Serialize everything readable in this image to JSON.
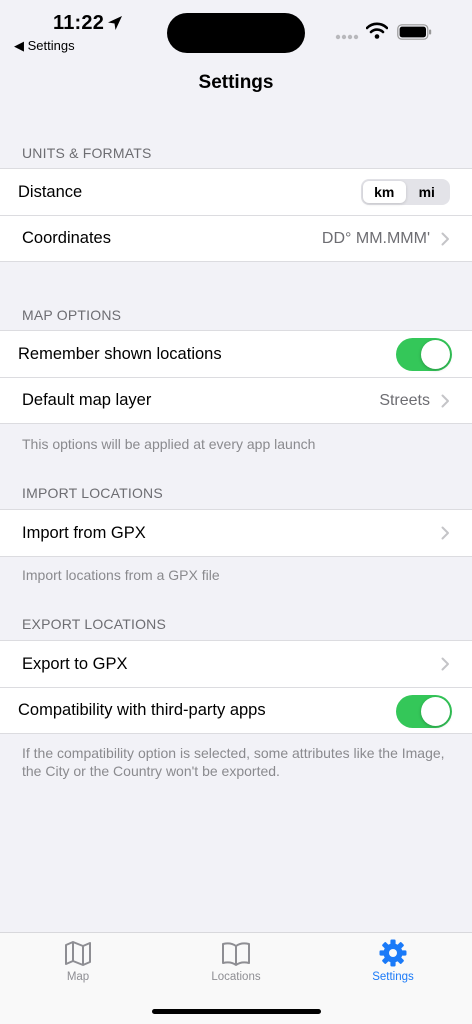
{
  "status": {
    "time": "11:22",
    "back_label": "◀ Settings"
  },
  "nav": {
    "title": "Settings"
  },
  "units": {
    "header": "UNITS & FORMATS",
    "distance_label": "Distance",
    "distance_options": [
      "km",
      "mi"
    ],
    "distance_selected": "km",
    "coordinates_label": "Coordinates",
    "coordinates_value": "DD° MM.MMM'"
  },
  "map_options": {
    "header": "MAP OPTIONS",
    "remember_label": "Remember shown locations",
    "remember_on": true,
    "layer_label": "Default map layer",
    "layer_value": "Streets",
    "footer": "This options will be applied at every app launch"
  },
  "import": {
    "header": "IMPORT LOCATIONS",
    "gpx_label": "Import from GPX",
    "footer": "Import locations from a GPX file"
  },
  "export": {
    "header": "EXPORT LOCATIONS",
    "gpx_label": "Export to GPX",
    "compat_label": "Compatibility with third-party apps",
    "compat_on": true,
    "footer": "If the compatibility option is selected, some attributes like the Image, the City or the Country won't be exported."
  },
  "tabs": [
    {
      "label": "Map",
      "icon": "map-icon",
      "active": false
    },
    {
      "label": "Locations",
      "icon": "book-icon",
      "active": false
    },
    {
      "label": "Settings",
      "icon": "gear-icon",
      "active": true
    }
  ],
  "colors": {
    "accent": "#1a7af8",
    "toggle_on": "#34c759",
    "background": "#f2f2f7"
  }
}
